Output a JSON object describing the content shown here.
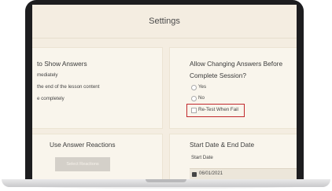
{
  "page": {
    "title": "Settings"
  },
  "show_answers": {
    "heading": "to Show Answers",
    "options": [
      "mediately",
      "the end of the lesson content",
      "e completely"
    ]
  },
  "allow_changing": {
    "heading_line1": "Allow Changing Answers Before",
    "heading_line2": "Complete Session?",
    "options": [
      "Yes",
      "No",
      "Re-Test When Fail"
    ]
  },
  "reactions": {
    "heading": "Use Answer Reactions",
    "button_label": "Select Reactions"
  },
  "dates": {
    "heading": "Start Date & End Date",
    "start_label": "Start Date",
    "start_value": "06/01/2021"
  }
}
